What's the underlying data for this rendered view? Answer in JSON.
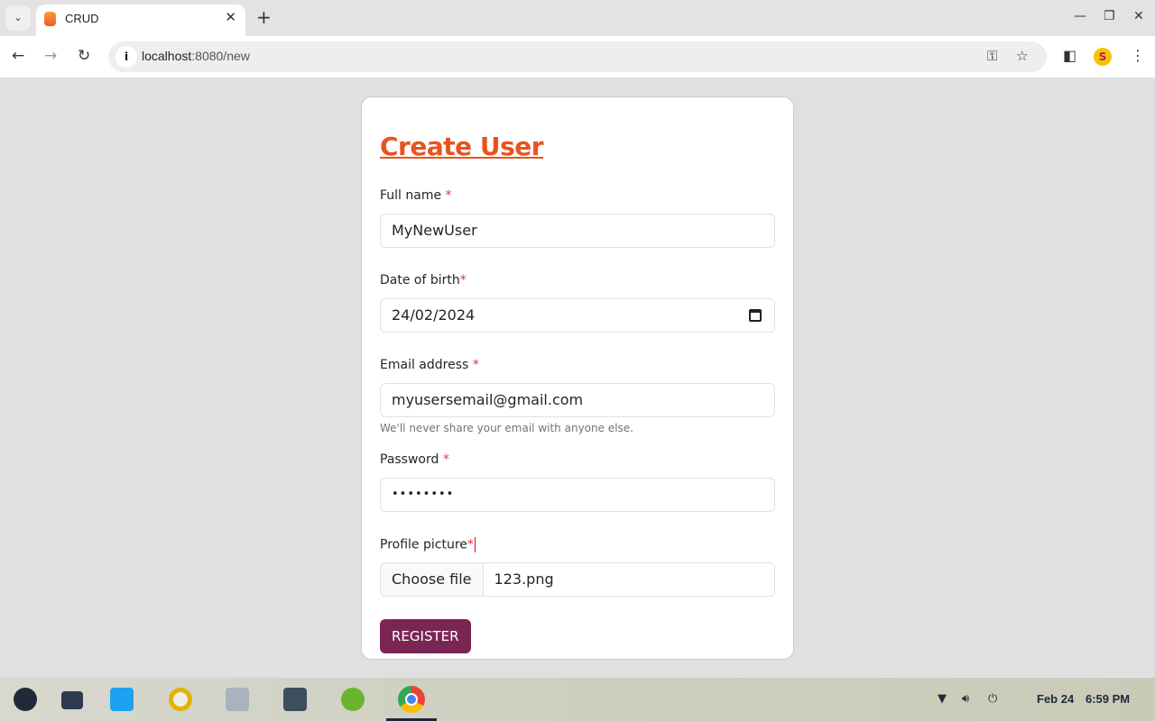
{
  "browser": {
    "tab_title": "CRUD",
    "url_host": "localhost",
    "url_path": ":8080/new"
  },
  "form": {
    "title": "Create User",
    "full_name": {
      "label": "Full name ",
      "required": "*",
      "value": "MyNewUser"
    },
    "dob": {
      "label": "Date of birth",
      "required": "*",
      "value": "24/02/2024"
    },
    "email": {
      "label": "Email address ",
      "required": "*",
      "value": "myusersemail@gmail.com",
      "help": "We'll never share your email with anyone else."
    },
    "password": {
      "label": "Password ",
      "required": "*",
      "value": "••••••••"
    },
    "picture": {
      "label": "Profile picture",
      "required": "*",
      "button": "Choose file",
      "file": "123.png"
    },
    "submit": "REGISTER"
  },
  "taskbar": {
    "date": "Feb 24",
    "time": "6:59 PM"
  },
  "colors": {
    "accent": "#e8531f",
    "button": "#7b2652",
    "required": "#dc3545"
  }
}
